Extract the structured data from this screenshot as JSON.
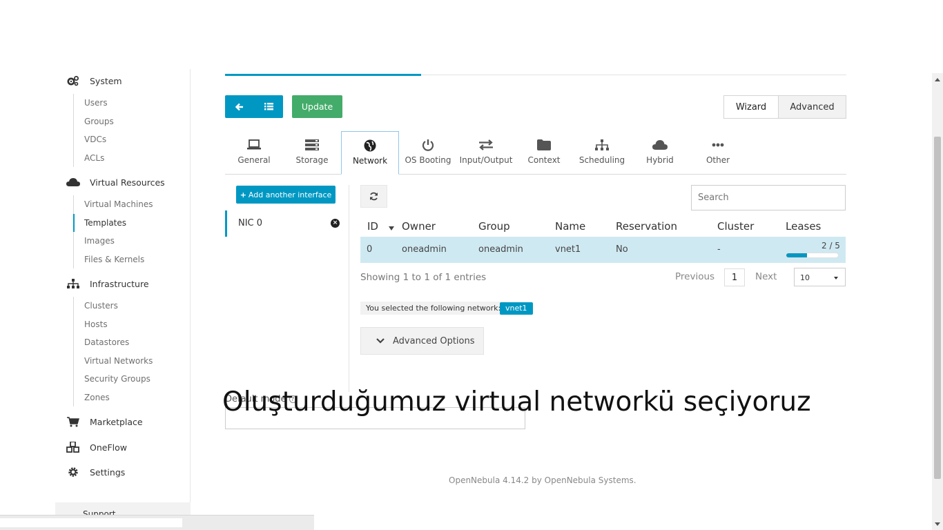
{
  "sidebar": {
    "system": {
      "label": "System",
      "items": [
        "Users",
        "Groups",
        "VDCs",
        "ACLs"
      ]
    },
    "virtual_resources": {
      "label": "Virtual Resources",
      "items": [
        "Virtual Machines",
        "Templates",
        "Images",
        "Files & Kernels"
      ],
      "active": "Templates"
    },
    "infrastructure": {
      "label": "Infrastructure",
      "items": [
        "Clusters",
        "Hosts",
        "Datastores",
        "Virtual Networks",
        "Security Groups",
        "Zones"
      ]
    },
    "marketplace": "Marketplace",
    "oneflow": "OneFlow",
    "settings": "Settings",
    "support": "Support"
  },
  "toolbar": {
    "update_label": "Update",
    "wizard_label": "Wizard",
    "advanced_label": "Advanced"
  },
  "wizard_tabs": [
    "General",
    "Storage",
    "Network",
    "OS Booting",
    "Input/Output",
    "Context",
    "Scheduling",
    "Hybrid",
    "Other"
  ],
  "active_tab": "Network",
  "nic": {
    "add_label": "Add another interface",
    "nic_label": "NIC 0"
  },
  "network_table": {
    "search_placeholder": "Search",
    "columns": [
      "ID",
      "Owner",
      "Group",
      "Name",
      "Reservation",
      "Cluster",
      "Leases"
    ],
    "rows": [
      {
        "id": "0",
        "owner": "oneadmin",
        "group": "oneadmin",
        "name": "vnet1",
        "reservation": "No",
        "cluster": "-",
        "leases": "2 / 5",
        "leases_fraction": 0.4
      }
    ],
    "showing": "Showing 1 to 1 of 1 entries",
    "previous": "Previous",
    "page": "1",
    "next": "Next",
    "page_size": "10"
  },
  "selection": {
    "note": "You selected the following network:",
    "network": "vnet1"
  },
  "advanced_options_label": "Advanced Options",
  "default_mode_label": "Default mode",
  "overlay_caption": "Oluşturduğumuz virtual networkü seçiyoruz",
  "footer": "OpenNebula 4.14.2 by OpenNebula Systems.",
  "colors": {
    "accent": "#0098c3",
    "success": "#43ac6a",
    "selected_row": "#cfe9f2"
  }
}
